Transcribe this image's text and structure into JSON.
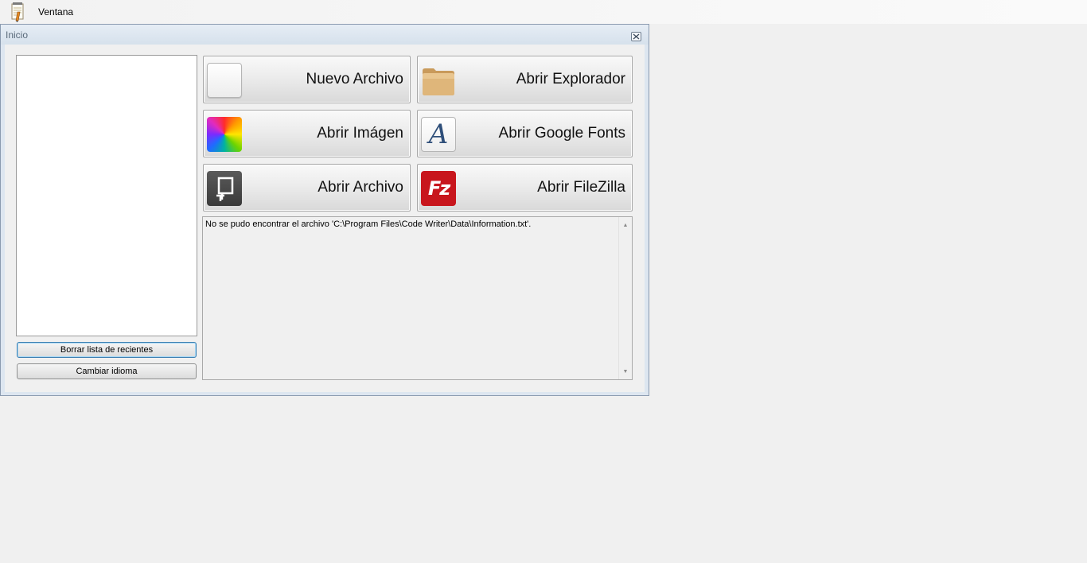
{
  "menubar": {
    "app_icon": "notepad-pencil-icon",
    "menu_items": [
      {
        "label": "Ventana"
      }
    ]
  },
  "window": {
    "title": "Inicio",
    "close_icon": "close-icon"
  },
  "sidebar": {
    "recent_items": [],
    "clear_recent_label": "Borrar lista de recientes",
    "change_language_label": "Cambiar idioma"
  },
  "actions": [
    {
      "label": "Nuevo Archivo",
      "icon": "blank-file-icon"
    },
    {
      "label": "Abrir Explorador",
      "icon": "folder-icon"
    },
    {
      "label": "Abrir Imágen",
      "icon": "image-icon"
    },
    {
      "label": "Abrir Google Fonts",
      "icon": "font-icon",
      "glyph": "A"
    },
    {
      "label": "Abrir Archivo",
      "icon": "open-file-icon"
    },
    {
      "label": "Abrir FileZilla",
      "icon": "filezilla-icon",
      "glyph": "Fz"
    }
  ],
  "log": {
    "text": "No se pudo encontrar el archivo 'C:\\Program Files\\Code Writer\\Data\\Information.txt'."
  },
  "colors": {
    "filezilla_red": "#c8161d",
    "font_icon_blue": "#2f4f7a",
    "focus_border": "#3c7fb1"
  }
}
